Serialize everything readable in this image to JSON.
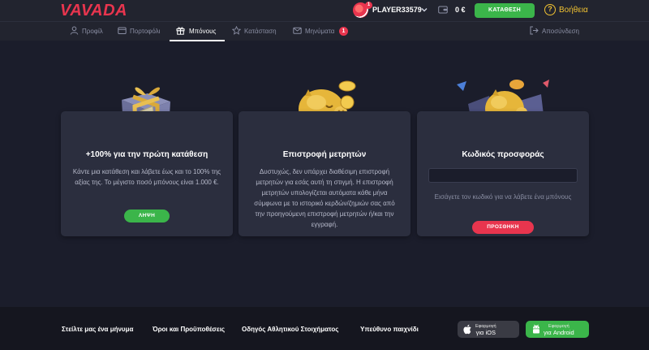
{
  "header": {
    "logo": "VAVADA",
    "avatar_badge": "1",
    "username": "PLAYER33579",
    "balance": "0 €",
    "deposit_label": "ΚΑΤΑΘΕΣΗ",
    "help_icon": "?",
    "help_label": "Βοήθεια"
  },
  "nav": {
    "items": [
      {
        "label": "Προφίλ",
        "icon": "user-icon"
      },
      {
        "label": "Πορτοφόλι",
        "icon": "wallet-icon"
      },
      {
        "label": "Μπόνους",
        "icon": "gift-icon",
        "active": true
      },
      {
        "label": "Κατάσταση",
        "icon": "star-icon"
      },
      {
        "label": "Μηνύματα",
        "icon": "mail-icon",
        "badge": "1"
      }
    ],
    "logout_label": "Αποσύνδεση"
  },
  "cards": [
    {
      "title": "+100% για την πρώτη κατάθεση",
      "text": "Κάντε μια κατάθεση και λάβετε έως και το 100% της αξίας της. Το μέγιστο ποσό μπόνους είναι 1.000 €.",
      "button": "ΛΗΨΗ",
      "button_color": "#3bb54a",
      "icon": "gift-box-icon"
    },
    {
      "title": "Επιστροφή μετρητών",
      "text": "Δυστυχώς, δεν υπάρχει διαθέσιμη επιστροφή μετρητών για εσάς αυτή τη στιγμή. Η επιστροφή μετρητών υπολογίζεται αυτόματα κάθε μήνα σύμφωνα με το ιστορικό κερδών/ζημιών σας από την προηγούμενη επιστροφή μετρητών ή/και την εγγραφή.",
      "icon": "piggy-bank-icon"
    },
    {
      "title": "Κωδικός προσφοράς",
      "input_placeholder": "",
      "hint": "Εισάγετε τον κωδικό για να λάβετε ένα μπόνους",
      "button": "ΠΡΟΣΘΗΚΗ",
      "button_color": "#e8354e",
      "icon": "promo-piggy-icon"
    }
  ],
  "footer": {
    "links": [
      "Στείλτε μας ένα μήνυμα",
      "Όροι και Προϋποθέσεις",
      "Οδηγός Αθλητικού Στοιχήματος",
      "Υπεύθυνο παιχνίδι"
    ],
    "ios": {
      "small": "Εφαρμογή",
      "big": "για iOS",
      "icon": "apple-icon"
    },
    "android": {
      "small": "Εφαρμογή",
      "big": "για Android",
      "icon": "android-icon"
    }
  },
  "colors": {
    "accent_red": "#e8354e",
    "accent_green": "#3bb54a",
    "help_yellow": "#f1c232",
    "background": "#1b1d2b",
    "card": "#2b2e3e"
  }
}
